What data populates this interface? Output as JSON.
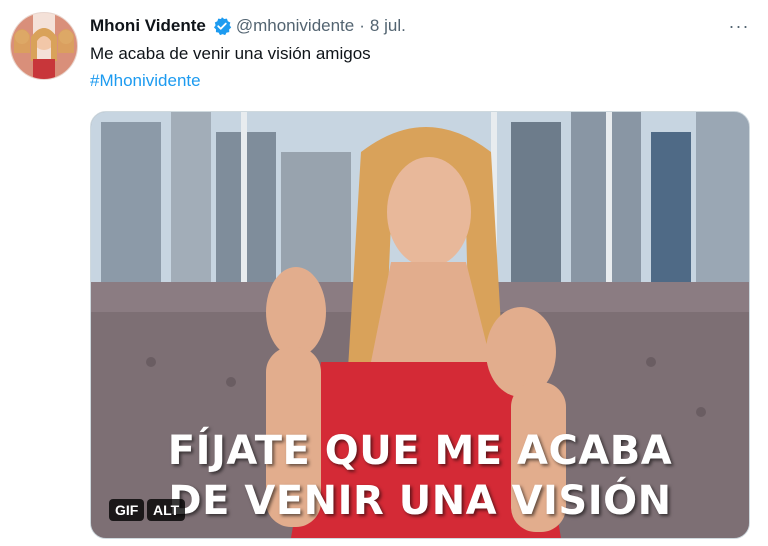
{
  "tweet": {
    "author_name": "Mhoni Vidente",
    "handle": "@mhonividente",
    "separator": "·",
    "date": "8 jul.",
    "more_icon": "···",
    "text": "Me acaba de venir una visión amigos",
    "hashtag": "#Mhonividente"
  },
  "media": {
    "caption_line1": "FÍJATE QUE ME ACABA",
    "caption_line2": "DE VENIR UNA VISIÓN",
    "gif_badge": "GIF",
    "alt_badge": "ALT"
  },
  "colors": {
    "link": "#1d9bf0",
    "verified": "#1d9bf0",
    "secondary_text": "#536471"
  }
}
